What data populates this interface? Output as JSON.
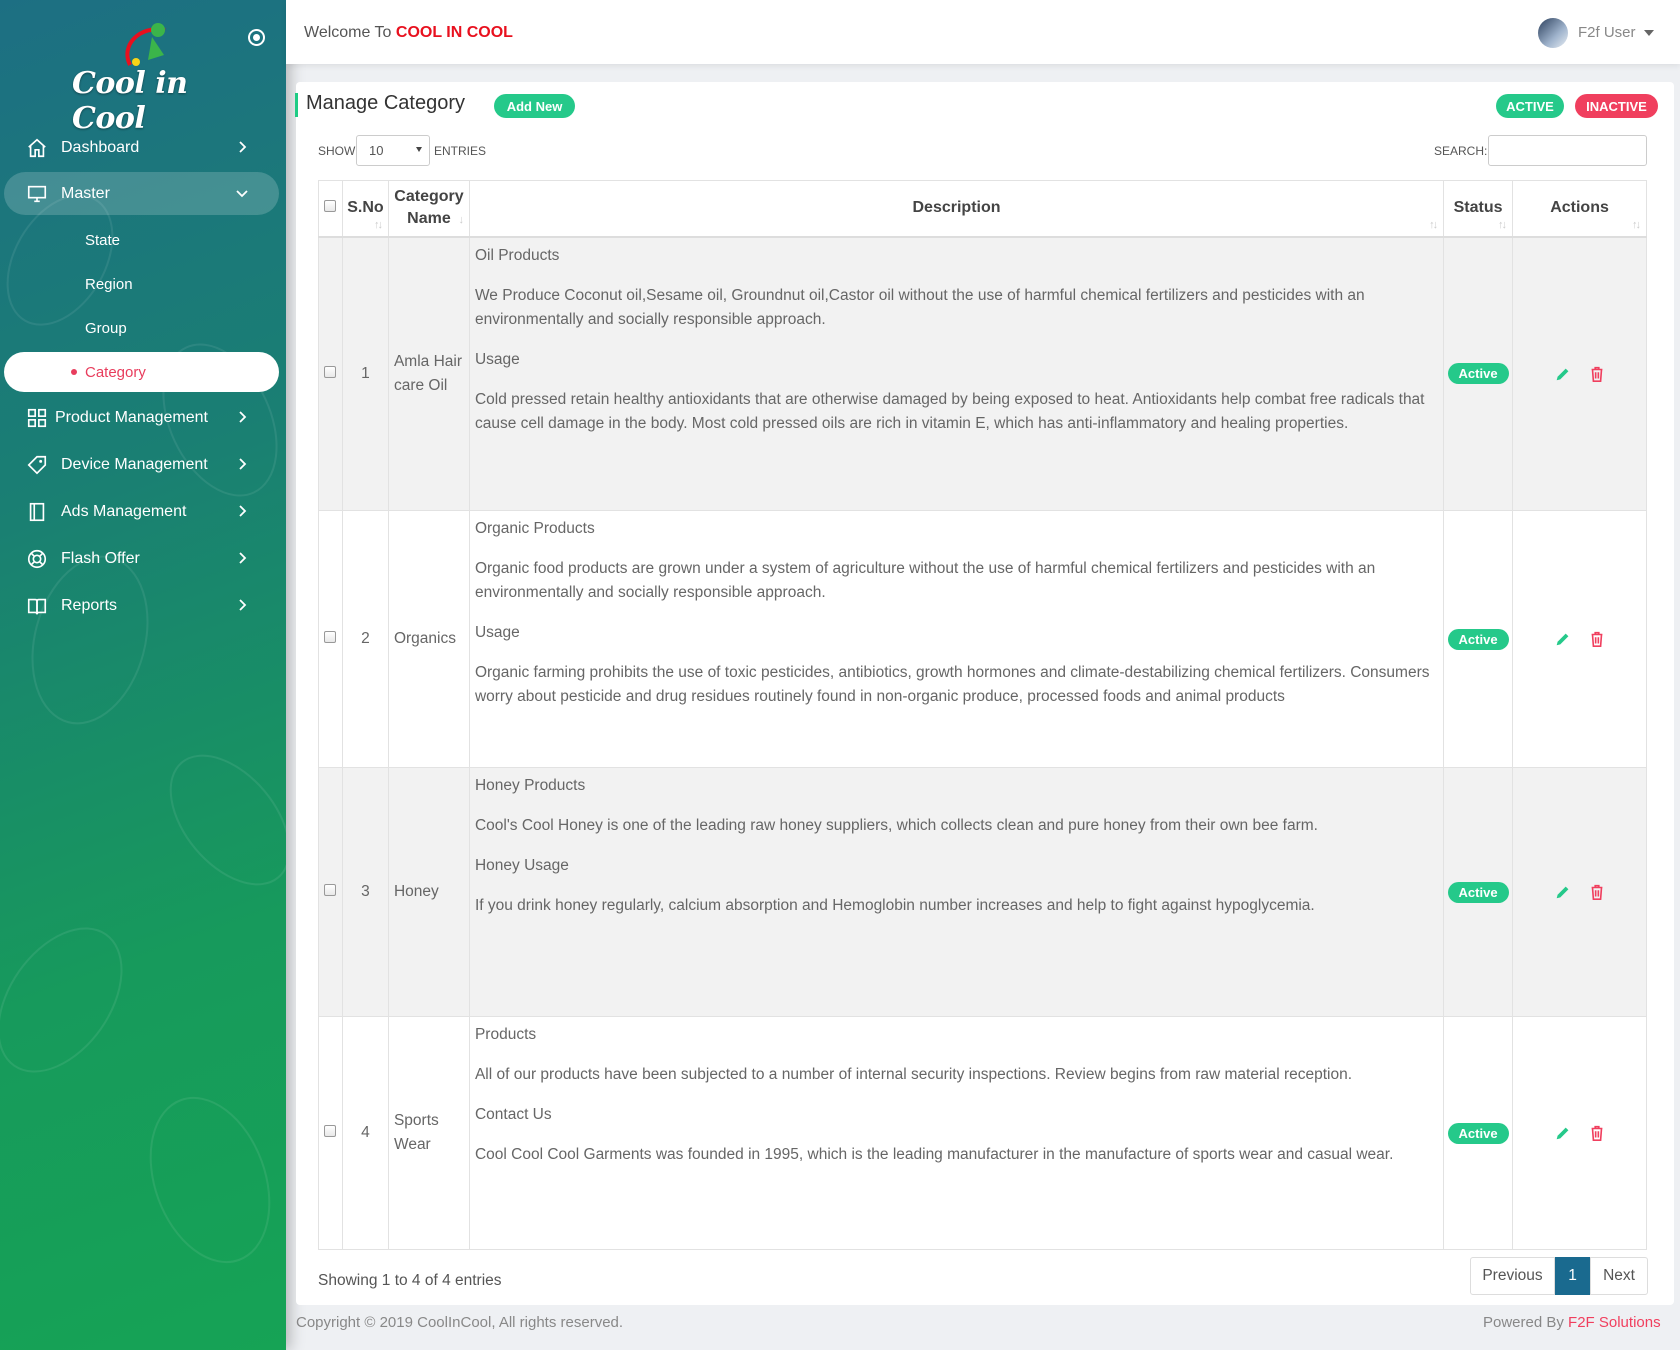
{
  "brand": {
    "logo_text": "Cool in Cool"
  },
  "header": {
    "welcome_prefix": "Welcome To",
    "welcome_brand": "COOL IN COOL",
    "user_name": "F2f User"
  },
  "sidebar": {
    "items": [
      {
        "label": "Dashboard",
        "icon": "home-icon"
      },
      {
        "label": "Master",
        "icon": "monitor-icon"
      },
      {
        "label": "Product Management",
        "icon": "grid-icon"
      },
      {
        "label": "Device Management",
        "icon": "tag-icon"
      },
      {
        "label": "Ads Management",
        "icon": "book-icon"
      },
      {
        "label": "Flash Offer",
        "icon": "lifebuoy-icon"
      },
      {
        "label": "Reports",
        "icon": "open-book-icon"
      }
    ],
    "sub_items": [
      {
        "label": "State"
      },
      {
        "label": "Region"
      },
      {
        "label": "Group"
      },
      {
        "label": "Category"
      }
    ]
  },
  "page": {
    "title": "Manage Category",
    "add_new": "Add New",
    "filter_active": "ACTIVE",
    "filter_inactive": "INACTIVE",
    "show_label": "SHOW",
    "entries_value": "10",
    "entries_label": "ENTRIES",
    "search_label": "SEARCH:",
    "info": "Showing 1 to 4 of 4 entries",
    "pagination": {
      "previous": "Previous",
      "current": "1",
      "next": "Next"
    }
  },
  "table": {
    "headers": {
      "sno": "S.No",
      "category": "Category Name",
      "description": "Description",
      "status": "Status",
      "actions": "Actions"
    },
    "rows": [
      {
        "sno": "1",
        "name": "Amla Hair care Oil",
        "desc": [
          "Oil Products",
          "We Produce Coconut oil,Sesame oil, Groundnut oil,Castor oil without the use of harmful chemical fertilizers and pesticides with an environmentally and socially responsible approach.",
          "Usage",
          "Cold pressed retain healthy antioxidants that are otherwise damaged by being exposed to heat. Antioxidants help combat free radicals that cause cell damage in the body. Most cold pressed oils are rich in vitamin E, which has anti-inflammatory and healing properties."
        ],
        "status": "Active"
      },
      {
        "sno": "2",
        "name": "Organics",
        "desc": [
          "Organic Products",
          "Organic food products are grown under a system of agriculture without the use of harmful chemical fertilizers and pesticides with an environmentally and socially responsible approach.",
          "Usage",
          "Organic farming prohibits the use of toxic pesticides, antibiotics, growth hormones and climate-destabilizing chemical fertilizers. Consumers worry about pesticide and drug residues routinely found in non-organic produce, processed foods and animal products"
        ],
        "status": "Active"
      },
      {
        "sno": "3",
        "name": "Honey",
        "desc": [
          "Honey Products",
          "Cool's Cool Honey is one of the leading raw honey suppliers, which collects clean and pure honey from their own bee farm.",
          "Honey Usage",
          "If you drink honey regularly, calcium absorption and Hemoglobin number increases and help to fight against hypoglycemia."
        ],
        "status": "Active"
      },
      {
        "sno": "4",
        "name": "Sports Wear",
        "desc": [
          "Products",
          "All of our products have been subjected to a number of internal security inspections. Review begins from raw material reception.",
          "Contact Us",
          "Cool Cool Cool Garments was founded in 1995, which is the leading manufacturer in the manufacture of sports wear and casual wear."
        ],
        "status": "Active"
      }
    ]
  },
  "footer": {
    "copyright": "Copyright © 2019 CoolInCool, All rights reserved.",
    "powered_prefix": "Powered By",
    "powered_brand": "F2F Solutions"
  },
  "colors": {
    "accent_green": "#25c98a",
    "accent_red": "#f03f5e",
    "pager_blue": "#1a6a8f",
    "brand_red": "#e8101e"
  }
}
